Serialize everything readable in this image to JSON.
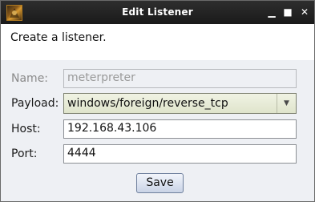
{
  "window": {
    "title": "Edit Listener",
    "controls": {
      "minimize": "▁",
      "maximize": "■",
      "close": "✕"
    }
  },
  "header": {
    "text": "Create a listener."
  },
  "form": {
    "name": {
      "label": "Name:",
      "value": "meterpreter",
      "enabled": false
    },
    "payload": {
      "label": "Payload:",
      "value": "windows/foreign/reverse_tcp"
    },
    "host": {
      "label": "Host:",
      "value": "192.168.43.106"
    },
    "port": {
      "label": "Port:",
      "value": "4444"
    }
  },
  "actions": {
    "save_label": "Save"
  },
  "icons": {
    "app": "armitage-app-icon",
    "dropdown": "chevron-down-icon"
  }
}
